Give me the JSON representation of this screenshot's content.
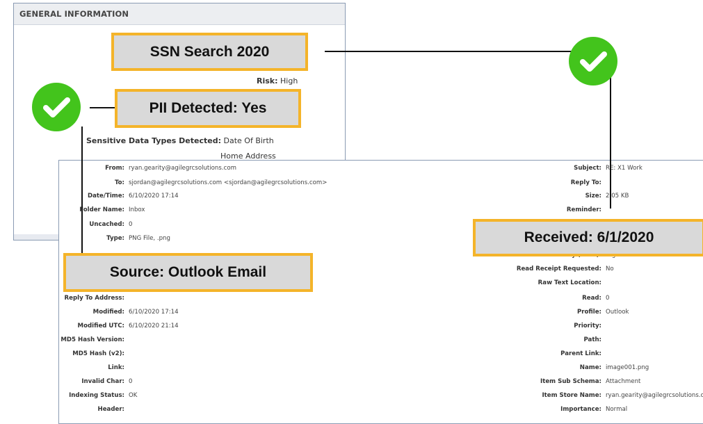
{
  "general": {
    "header": "GENERAL INFORMATION",
    "risk_label": "Risk:",
    "risk_value": "High",
    "sensitive_label": "Sensitive Data Types Detected:",
    "sensitive_values": [
      "Date Of Birth",
      "Home Address"
    ]
  },
  "details_left": [
    {
      "label": "From:",
      "value": "ryan.gearity@agilegrcsolutions.com"
    },
    {
      "label": "To:",
      "value": "sjordan@agilegrcsolutions.com <sjordan@agilegrcsolutions.com>"
    },
    {
      "label": "Date/Time:",
      "value": "6/10/2020 17:14"
    },
    {
      "label": "Folder Name:",
      "value": "Inbox"
    },
    {
      "label": "Uncached:",
      "value": "0"
    },
    {
      "label": "Type:",
      "value": "PNG File, .png"
    },
    {
      "label": "Reply To Address:",
      "value": ""
    },
    {
      "label": "Modified:",
      "value": "6/10/2020 17:14"
    },
    {
      "label": "Modified UTC:",
      "value": "6/10/2020 21:14"
    },
    {
      "label": "MD5 Hash Version:",
      "value": ""
    },
    {
      "label": "MD5 Hash (v2):",
      "value": ""
    },
    {
      "label": "Link:",
      "value": ""
    },
    {
      "label": "Invalid Char:",
      "value": "0"
    },
    {
      "label": "Indexing Status:",
      "value": "OK"
    },
    {
      "label": "Header:",
      "value": ""
    }
  ],
  "details_right": [
    {
      "label": "Subject:",
      "value": "RE: X1 Work"
    },
    {
      "label": "Reply To:",
      "value": ""
    },
    {
      "label": "Size:",
      "value": "2.05 KB"
    },
    {
      "label": "Reminder:",
      "value": ""
    },
    {
      "label": "Sensitivity (Data):",
      "value": "High"
    },
    {
      "label": "Read Receipt Requested:",
      "value": "No"
    },
    {
      "label": "Raw Text Location:",
      "value": ""
    },
    {
      "label": "Read:",
      "value": "0"
    },
    {
      "label": "Profile:",
      "value": "Outlook"
    },
    {
      "label": "Priority:",
      "value": ""
    },
    {
      "label": "Path:",
      "value": ""
    },
    {
      "label": "Parent Link:",
      "value": ""
    },
    {
      "label": "Name:",
      "value": "image001.png"
    },
    {
      "label": "Item Sub Schema:",
      "value": "Attachment"
    },
    {
      "label": "Item Store Name:",
      "value": "ryan.gearity@agilegrcsolutions.com"
    },
    {
      "label": "Importance:",
      "value": "Normal"
    }
  ],
  "callouts": {
    "ssn": "SSN Search 2020",
    "pii": "PII Detected: Yes",
    "received": "Received: 6/1/2020",
    "source": "Source: Outlook Email"
  },
  "colors": {
    "callout_border": "#f4b42a",
    "callout_fill": "#d9d9d9",
    "check_green": "#43c41c"
  },
  "icons": [
    "check-icon"
  ]
}
